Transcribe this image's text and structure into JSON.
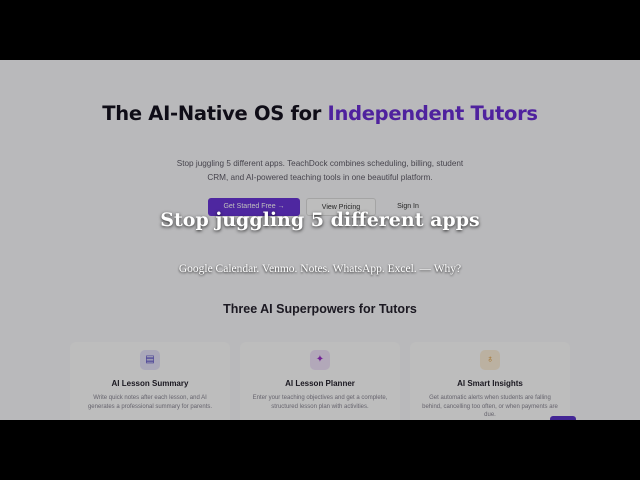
{
  "hero": {
    "title_main": "The AI-Native OS for ",
    "title_accent": "Independent Tutors",
    "subtitle": "Stop juggling 5 different apps. TeachDock combines scheduling, billing, student CRM, and AI-powered teaching tools in one beautiful platform.",
    "cta_primary": "Get Started Free →",
    "cta_secondary": "View Pricing",
    "cta_signin": "Sign In"
  },
  "features": {
    "heading": "Three AI Superpowers for Tutors",
    "items": [
      {
        "icon": "document-icon",
        "glyph": "▤",
        "title": "AI Lesson Summary",
        "description": "Write quick notes after each lesson, and AI generates a professional summary for parents."
      },
      {
        "icon": "sparkle-icon",
        "glyph": "✦",
        "title": "AI Lesson Planner",
        "description": "Enter your teaching objectives and get a complete, structured lesson plan with activities."
      },
      {
        "icon": "lightbulb-icon",
        "glyph": "♁",
        "title": "AI Smart Insights",
        "description": "Get automatic alerts when students are falling behind, cancelling too often, or when payments are due."
      }
    ]
  },
  "overlay": {
    "caption_title": "Stop juggling 5 different apps",
    "caption_subtitle": "Google Calendar. Venmo. Notes. WhatsApp. Excel. — Why?"
  },
  "colors": {
    "accent": "#6b2fd6",
    "primary_button": "#6a35d8",
    "letterbox": "#000000"
  }
}
